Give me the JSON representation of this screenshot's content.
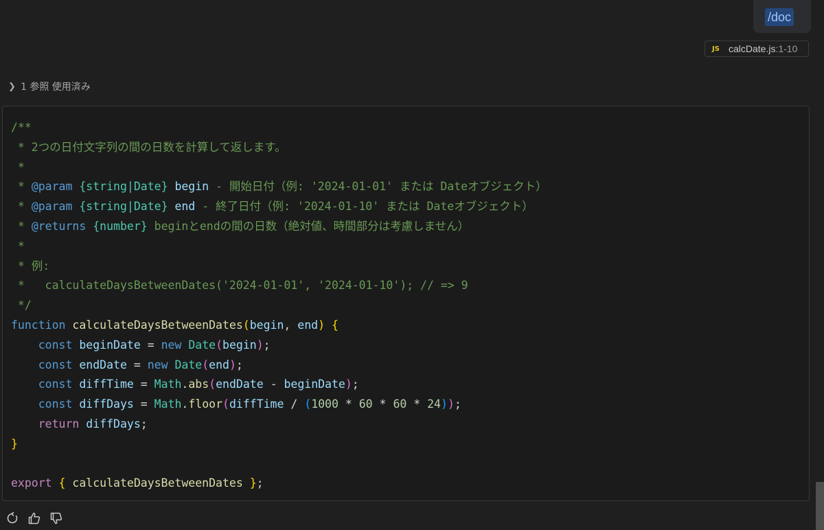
{
  "prompt": {
    "text": "/doc"
  },
  "file_reference": {
    "icon": "JS",
    "name": "calcDate.js",
    "range": ":1-10"
  },
  "references": {
    "label": "1 参照 使用済み"
  },
  "code": {
    "lines": [
      [
        [
          "c-com",
          "/**"
        ]
      ],
      [
        [
          "c-com",
          " * 2つの日付文字列の間の日数を計算して返します。"
        ]
      ],
      [
        [
          "c-com",
          " *"
        ]
      ],
      [
        [
          "c-com",
          " * "
        ],
        [
          "c-tag",
          "@param"
        ],
        [
          "c-com",
          " "
        ],
        [
          "c-type",
          "{string|Date}"
        ],
        [
          "c-com",
          " "
        ],
        [
          "c-var",
          "begin"
        ],
        [
          "c-com",
          " - 開始日付（例: '2024-01-01' または Dateオブジェクト）"
        ]
      ],
      [
        [
          "c-com",
          " * "
        ],
        [
          "c-tag",
          "@param"
        ],
        [
          "c-com",
          " "
        ],
        [
          "c-type",
          "{string|Date}"
        ],
        [
          "c-com",
          " "
        ],
        [
          "c-var",
          "end"
        ],
        [
          "c-com",
          " - 終了日付（例: '2024-01-10' または Dateオブジェクト）"
        ]
      ],
      [
        [
          "c-com",
          " * "
        ],
        [
          "c-tag",
          "@returns"
        ],
        [
          "c-com",
          " "
        ],
        [
          "c-type",
          "{number}"
        ],
        [
          "c-com",
          " beginとendの間の日数（絶対値、時間部分は考慮しません）"
        ]
      ],
      [
        [
          "c-com",
          " *"
        ]
      ],
      [
        [
          "c-com",
          " * 例:"
        ]
      ],
      [
        [
          "c-com",
          " *   calculateDaysBetweenDates('2024-01-01', '2024-01-10'); // => 9"
        ]
      ],
      [
        [
          "c-com",
          " */"
        ]
      ],
      [
        [
          "c-kw",
          "function"
        ],
        [
          "c-op",
          " "
        ],
        [
          "c-fn",
          "calculateDaysBetweenDates"
        ],
        [
          "c-b1",
          "("
        ],
        [
          "c-var",
          "begin"
        ],
        [
          "c-op",
          ", "
        ],
        [
          "c-var",
          "end"
        ],
        [
          "c-b1",
          ")"
        ],
        [
          "c-op",
          " "
        ],
        [
          "c-b1",
          "{"
        ]
      ],
      [
        [
          "c-op",
          "    "
        ],
        [
          "c-kw",
          "const"
        ],
        [
          "c-op",
          " "
        ],
        [
          "c-var",
          "beginDate"
        ],
        [
          "c-op",
          " = "
        ],
        [
          "c-kw",
          "new"
        ],
        [
          "c-op",
          " "
        ],
        [
          "c-type",
          "Date"
        ],
        [
          "c-b2",
          "("
        ],
        [
          "c-var",
          "begin"
        ],
        [
          "c-b2",
          ")"
        ],
        [
          "c-op",
          ";"
        ]
      ],
      [
        [
          "c-op",
          "    "
        ],
        [
          "c-kw",
          "const"
        ],
        [
          "c-op",
          " "
        ],
        [
          "c-var",
          "endDate"
        ],
        [
          "c-op",
          " = "
        ],
        [
          "c-kw",
          "new"
        ],
        [
          "c-op",
          " "
        ],
        [
          "c-type",
          "Date"
        ],
        [
          "c-b2",
          "("
        ],
        [
          "c-var",
          "end"
        ],
        [
          "c-b2",
          ")"
        ],
        [
          "c-op",
          ";"
        ]
      ],
      [
        [
          "c-op",
          "    "
        ],
        [
          "c-kw",
          "const"
        ],
        [
          "c-op",
          " "
        ],
        [
          "c-var",
          "diffTime"
        ],
        [
          "c-op",
          " = "
        ],
        [
          "c-type",
          "Math"
        ],
        [
          "c-op",
          "."
        ],
        [
          "c-fn",
          "abs"
        ],
        [
          "c-b2",
          "("
        ],
        [
          "c-var",
          "endDate"
        ],
        [
          "c-op",
          " - "
        ],
        [
          "c-var",
          "beginDate"
        ],
        [
          "c-b2",
          ")"
        ],
        [
          "c-op",
          ";"
        ]
      ],
      [
        [
          "c-op",
          "    "
        ],
        [
          "c-kw",
          "const"
        ],
        [
          "c-op",
          " "
        ],
        [
          "c-var",
          "diffDays"
        ],
        [
          "c-op",
          " = "
        ],
        [
          "c-type",
          "Math"
        ],
        [
          "c-op",
          "."
        ],
        [
          "c-fn",
          "floor"
        ],
        [
          "c-b2",
          "("
        ],
        [
          "c-var",
          "diffTime"
        ],
        [
          "c-op",
          " / "
        ],
        [
          "c-b3",
          "("
        ],
        [
          "c-num",
          "1000"
        ],
        [
          "c-op",
          " * "
        ],
        [
          "c-num",
          "60"
        ],
        [
          "c-op",
          " * "
        ],
        [
          "c-num",
          "60"
        ],
        [
          "c-op",
          " * "
        ],
        [
          "c-num",
          "24"
        ],
        [
          "c-b3",
          ")"
        ],
        [
          "c-b2",
          ")"
        ],
        [
          "c-op",
          ";"
        ]
      ],
      [
        [
          "c-op",
          "    "
        ],
        [
          "c-ctrl",
          "return"
        ],
        [
          "c-op",
          " "
        ],
        [
          "c-var",
          "diffDays"
        ],
        [
          "c-op",
          ";"
        ]
      ],
      [
        [
          "c-b1",
          "}"
        ]
      ],
      [
        [
          "c-op",
          " "
        ]
      ],
      [
        [
          "c-ctrl",
          "export"
        ],
        [
          "c-op",
          " "
        ],
        [
          "c-b1",
          "{"
        ],
        [
          "c-op",
          " "
        ],
        [
          "c-fn",
          "calculateDaysBetweenDates"
        ],
        [
          "c-op",
          " "
        ],
        [
          "c-b1",
          "}"
        ],
        [
          "c-op",
          ";"
        ]
      ]
    ]
  },
  "actions": [
    {
      "name": "retry-button",
      "icon": "retry-icon"
    },
    {
      "name": "thumbs-up-button",
      "icon": "thumbs-up-icon"
    },
    {
      "name": "thumbs-down-button",
      "icon": "thumbs-down-icon"
    }
  ]
}
